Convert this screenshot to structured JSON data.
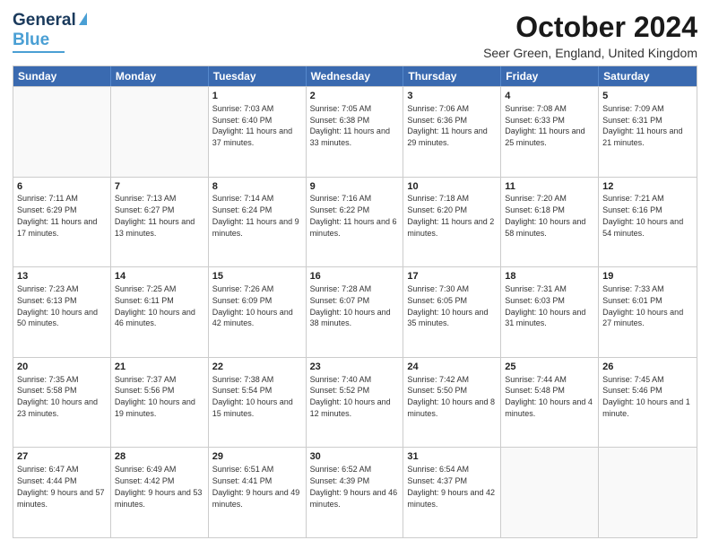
{
  "logo": {
    "line1": "General",
    "line2": "Blue"
  },
  "title": "October 2024",
  "location": "Seer Green, England, United Kingdom",
  "days": [
    "Sunday",
    "Monday",
    "Tuesday",
    "Wednesday",
    "Thursday",
    "Friday",
    "Saturday"
  ],
  "rows": [
    [
      {
        "day": "",
        "sunrise": "",
        "sunset": "",
        "daylight": ""
      },
      {
        "day": "",
        "sunrise": "",
        "sunset": "",
        "daylight": ""
      },
      {
        "day": "1",
        "sunrise": "Sunrise: 7:03 AM",
        "sunset": "Sunset: 6:40 PM",
        "daylight": "Daylight: 11 hours and 37 minutes."
      },
      {
        "day": "2",
        "sunrise": "Sunrise: 7:05 AM",
        "sunset": "Sunset: 6:38 PM",
        "daylight": "Daylight: 11 hours and 33 minutes."
      },
      {
        "day": "3",
        "sunrise": "Sunrise: 7:06 AM",
        "sunset": "Sunset: 6:36 PM",
        "daylight": "Daylight: 11 hours and 29 minutes."
      },
      {
        "day": "4",
        "sunrise": "Sunrise: 7:08 AM",
        "sunset": "Sunset: 6:33 PM",
        "daylight": "Daylight: 11 hours and 25 minutes."
      },
      {
        "day": "5",
        "sunrise": "Sunrise: 7:09 AM",
        "sunset": "Sunset: 6:31 PM",
        "daylight": "Daylight: 11 hours and 21 minutes."
      }
    ],
    [
      {
        "day": "6",
        "sunrise": "Sunrise: 7:11 AM",
        "sunset": "Sunset: 6:29 PM",
        "daylight": "Daylight: 11 hours and 17 minutes."
      },
      {
        "day": "7",
        "sunrise": "Sunrise: 7:13 AM",
        "sunset": "Sunset: 6:27 PM",
        "daylight": "Daylight: 11 hours and 13 minutes."
      },
      {
        "day": "8",
        "sunrise": "Sunrise: 7:14 AM",
        "sunset": "Sunset: 6:24 PM",
        "daylight": "Daylight: 11 hours and 9 minutes."
      },
      {
        "day": "9",
        "sunrise": "Sunrise: 7:16 AM",
        "sunset": "Sunset: 6:22 PM",
        "daylight": "Daylight: 11 hours and 6 minutes."
      },
      {
        "day": "10",
        "sunrise": "Sunrise: 7:18 AM",
        "sunset": "Sunset: 6:20 PM",
        "daylight": "Daylight: 11 hours and 2 minutes."
      },
      {
        "day": "11",
        "sunrise": "Sunrise: 7:20 AM",
        "sunset": "Sunset: 6:18 PM",
        "daylight": "Daylight: 10 hours and 58 minutes."
      },
      {
        "day": "12",
        "sunrise": "Sunrise: 7:21 AM",
        "sunset": "Sunset: 6:16 PM",
        "daylight": "Daylight: 10 hours and 54 minutes."
      }
    ],
    [
      {
        "day": "13",
        "sunrise": "Sunrise: 7:23 AM",
        "sunset": "Sunset: 6:13 PM",
        "daylight": "Daylight: 10 hours and 50 minutes."
      },
      {
        "day": "14",
        "sunrise": "Sunrise: 7:25 AM",
        "sunset": "Sunset: 6:11 PM",
        "daylight": "Daylight: 10 hours and 46 minutes."
      },
      {
        "day": "15",
        "sunrise": "Sunrise: 7:26 AM",
        "sunset": "Sunset: 6:09 PM",
        "daylight": "Daylight: 10 hours and 42 minutes."
      },
      {
        "day": "16",
        "sunrise": "Sunrise: 7:28 AM",
        "sunset": "Sunset: 6:07 PM",
        "daylight": "Daylight: 10 hours and 38 minutes."
      },
      {
        "day": "17",
        "sunrise": "Sunrise: 7:30 AM",
        "sunset": "Sunset: 6:05 PM",
        "daylight": "Daylight: 10 hours and 35 minutes."
      },
      {
        "day": "18",
        "sunrise": "Sunrise: 7:31 AM",
        "sunset": "Sunset: 6:03 PM",
        "daylight": "Daylight: 10 hours and 31 minutes."
      },
      {
        "day": "19",
        "sunrise": "Sunrise: 7:33 AM",
        "sunset": "Sunset: 6:01 PM",
        "daylight": "Daylight: 10 hours and 27 minutes."
      }
    ],
    [
      {
        "day": "20",
        "sunrise": "Sunrise: 7:35 AM",
        "sunset": "Sunset: 5:58 PM",
        "daylight": "Daylight: 10 hours and 23 minutes."
      },
      {
        "day": "21",
        "sunrise": "Sunrise: 7:37 AM",
        "sunset": "Sunset: 5:56 PM",
        "daylight": "Daylight: 10 hours and 19 minutes."
      },
      {
        "day": "22",
        "sunrise": "Sunrise: 7:38 AM",
        "sunset": "Sunset: 5:54 PM",
        "daylight": "Daylight: 10 hours and 15 minutes."
      },
      {
        "day": "23",
        "sunrise": "Sunrise: 7:40 AM",
        "sunset": "Sunset: 5:52 PM",
        "daylight": "Daylight: 10 hours and 12 minutes."
      },
      {
        "day": "24",
        "sunrise": "Sunrise: 7:42 AM",
        "sunset": "Sunset: 5:50 PM",
        "daylight": "Daylight: 10 hours and 8 minutes."
      },
      {
        "day": "25",
        "sunrise": "Sunrise: 7:44 AM",
        "sunset": "Sunset: 5:48 PM",
        "daylight": "Daylight: 10 hours and 4 minutes."
      },
      {
        "day": "26",
        "sunrise": "Sunrise: 7:45 AM",
        "sunset": "Sunset: 5:46 PM",
        "daylight": "Daylight: 10 hours and 1 minute."
      }
    ],
    [
      {
        "day": "27",
        "sunrise": "Sunrise: 6:47 AM",
        "sunset": "Sunset: 4:44 PM",
        "daylight": "Daylight: 9 hours and 57 minutes."
      },
      {
        "day": "28",
        "sunrise": "Sunrise: 6:49 AM",
        "sunset": "Sunset: 4:42 PM",
        "daylight": "Daylight: 9 hours and 53 minutes."
      },
      {
        "day": "29",
        "sunrise": "Sunrise: 6:51 AM",
        "sunset": "Sunset: 4:41 PM",
        "daylight": "Daylight: 9 hours and 49 minutes."
      },
      {
        "day": "30",
        "sunrise": "Sunrise: 6:52 AM",
        "sunset": "Sunset: 4:39 PM",
        "daylight": "Daylight: 9 hours and 46 minutes."
      },
      {
        "day": "31",
        "sunrise": "Sunrise: 6:54 AM",
        "sunset": "Sunset: 4:37 PM",
        "daylight": "Daylight: 9 hours and 42 minutes."
      },
      {
        "day": "",
        "sunrise": "",
        "sunset": "",
        "daylight": ""
      },
      {
        "day": "",
        "sunrise": "",
        "sunset": "",
        "daylight": ""
      }
    ]
  ]
}
